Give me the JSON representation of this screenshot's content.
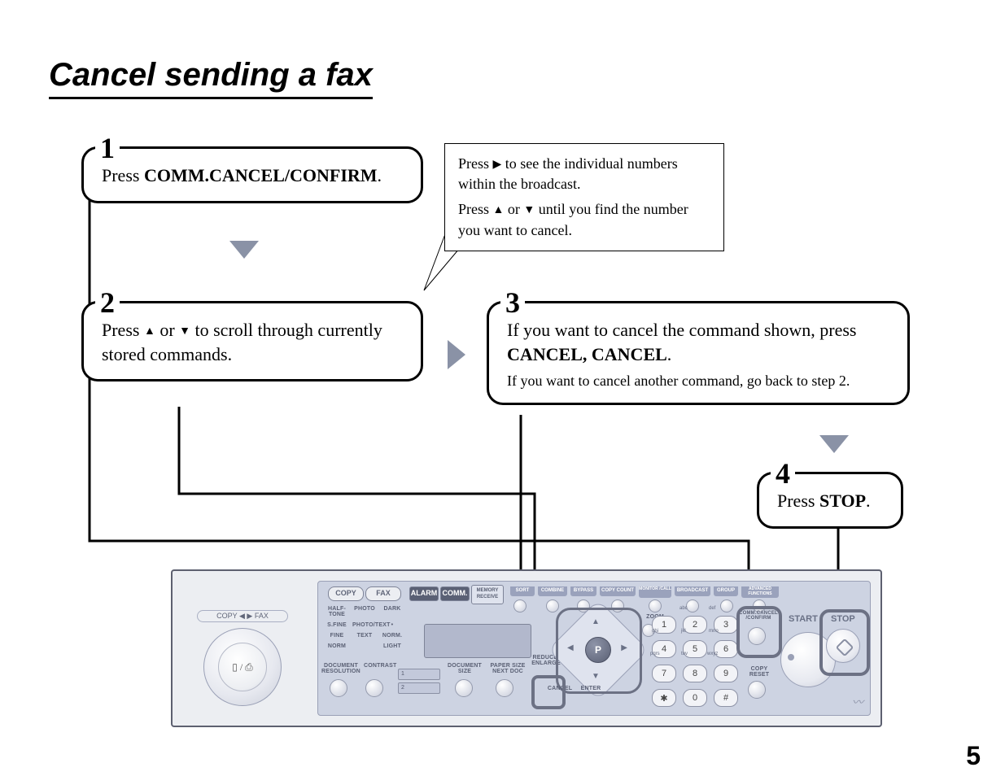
{
  "title": "Cancel sending a fax",
  "page_number": "5",
  "steps": {
    "s1": {
      "num": "1",
      "pre": "Press ",
      "bold": "COMM.CANCEL/CONFIRM",
      "post": "."
    },
    "s2": {
      "num": "2",
      "pre": "Press ",
      "mid": " or ",
      "post": " to scroll through currently stored commands."
    },
    "s3": {
      "num": "3",
      "line1_pre": "If you want to cancel the command shown, press ",
      "line1_bold": "CANCEL, CANCEL",
      "line1_post": ".",
      "sub": "If you want to cancel another command, go back to step 2."
    },
    "s4": {
      "num": "4",
      "pre": "Press ",
      "bold": "STOP",
      "post": "."
    }
  },
  "callout": {
    "l1_pre": "Press ",
    "l1_post": " to see the individual numbers within the broadcast.",
    "l2_pre": "Press ",
    "l2_mid": " or ",
    "l2_post": " until you find the number you want to cancel."
  },
  "panel": {
    "knob_label": "COPY ◀ ▶ FAX",
    "knob_icon": "▯ / ⎙",
    "mode_copy": "COPY",
    "mode_fax": "FAX",
    "status": {
      "alarm": "ALARM",
      "comm": "COMM.",
      "mem": "MEMORY\nRECEIVE"
    },
    "tabs": [
      "SORT",
      "COMBINE",
      "BYPASS",
      "COPY COUNT",
      "MONITOR /CALL",
      "BROADCAST",
      "GROUP",
      "ADVANCED FUNCTIONS"
    ],
    "left_rows": [
      [
        "HALF-TONE",
        "PHOTO",
        "DARK"
      ],
      [
        "S.FINE",
        "PHOTO/TEXT",
        "•"
      ],
      [
        "FINE",
        "TEXT",
        "NORM."
      ],
      [
        "NORM",
        "",
        "LIGHT"
      ]
    ],
    "left_bottom": [
      "DOCUMENT RESOLUTION",
      "CONTRAST"
    ],
    "under": [
      "DOCUMENT SIZE",
      "PAPER SIZE NEXT DOC"
    ],
    "reduce": "REDUCE/\nENLARGE",
    "zoom": "ZOOM",
    "arrow_lbl": {
      "cancel": "CANCEL",
      "enter": "ENTER"
    },
    "keypad_sub": [
      "abc",
      "def",
      "ghi",
      "jkl",
      "mno",
      "pqrs",
      "tuv",
      "wxyz"
    ],
    "keys": [
      [
        "1",
        "2",
        "3"
      ],
      [
        "4",
        "5",
        "6"
      ],
      [
        "7",
        "8",
        "9"
      ],
      [
        "✱",
        "0",
        "#"
      ]
    ],
    "comm_cancel": "COMM.CANCEL\n/CONFIRM",
    "copy_reset": "COPY\nRESET",
    "start": "START",
    "stop": "STOP",
    "tray": [
      "1",
      "2"
    ]
  }
}
